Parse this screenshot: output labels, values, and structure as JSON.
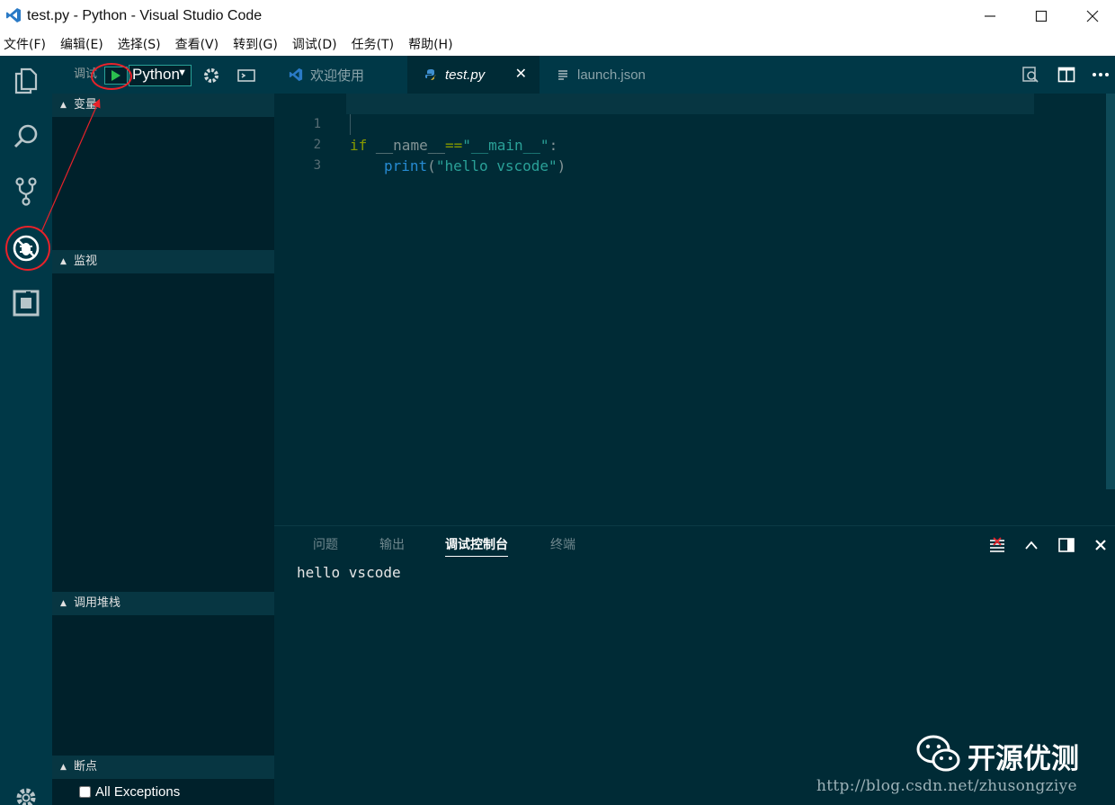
{
  "window": {
    "title": "test.py - Python - Visual Studio Code",
    "buttons": {
      "minimize": "─",
      "maximize": "☐",
      "close": "✕"
    }
  },
  "menu": [
    "文件(F)",
    "编辑(E)",
    "选择(S)",
    "查看(V)",
    "转到(G)",
    "调试(D)",
    "任务(T)",
    "帮助(H)"
  ],
  "activity_bar": [
    "files-icon",
    "search-icon",
    "source-control-icon",
    "debug-icon",
    "extensions-icon",
    "settings-gear-icon"
  ],
  "debug": {
    "label": "调试",
    "config": "Python",
    "sections": {
      "variables": "变量",
      "watch": "监视",
      "call_stack": "调用堆栈",
      "breakpoints": "断点"
    },
    "breakpoint_items": [
      {
        "label": "All Exceptions",
        "checked": false
      }
    ]
  },
  "tabs": [
    {
      "label": "欢迎使用",
      "icon": "vscode-icon",
      "active": false
    },
    {
      "label": "test.py",
      "icon": "python-icon",
      "active": true
    },
    {
      "label": "launch.json",
      "icon": "file-lines-icon",
      "active": false
    }
  ],
  "editor": {
    "line_numbers": [
      "1",
      "2",
      "3"
    ],
    "line1": {
      "kw": "if",
      "sp": " ",
      "name": "__name__",
      "op": "==",
      "str": "\"__main__\"",
      "colon": ":"
    },
    "line2": {
      "fn": "print",
      "open": "(",
      "str": "\"hello vscode\"",
      "close": ")"
    }
  },
  "panel": {
    "tabs": [
      "问题",
      "输出",
      "调试控制台",
      "终端"
    ],
    "active_tab": "调试控制台",
    "output": "hello vscode"
  },
  "watermark": {
    "brand": "开源优测",
    "url": "http://blog.csdn.net/zhusongziye"
  },
  "colors": {
    "background": "#002b36",
    "activity_bar": "#003847",
    "sidebar": "#00212b",
    "annotation_red": "#e8222a",
    "start_green": "#2aa198"
  }
}
